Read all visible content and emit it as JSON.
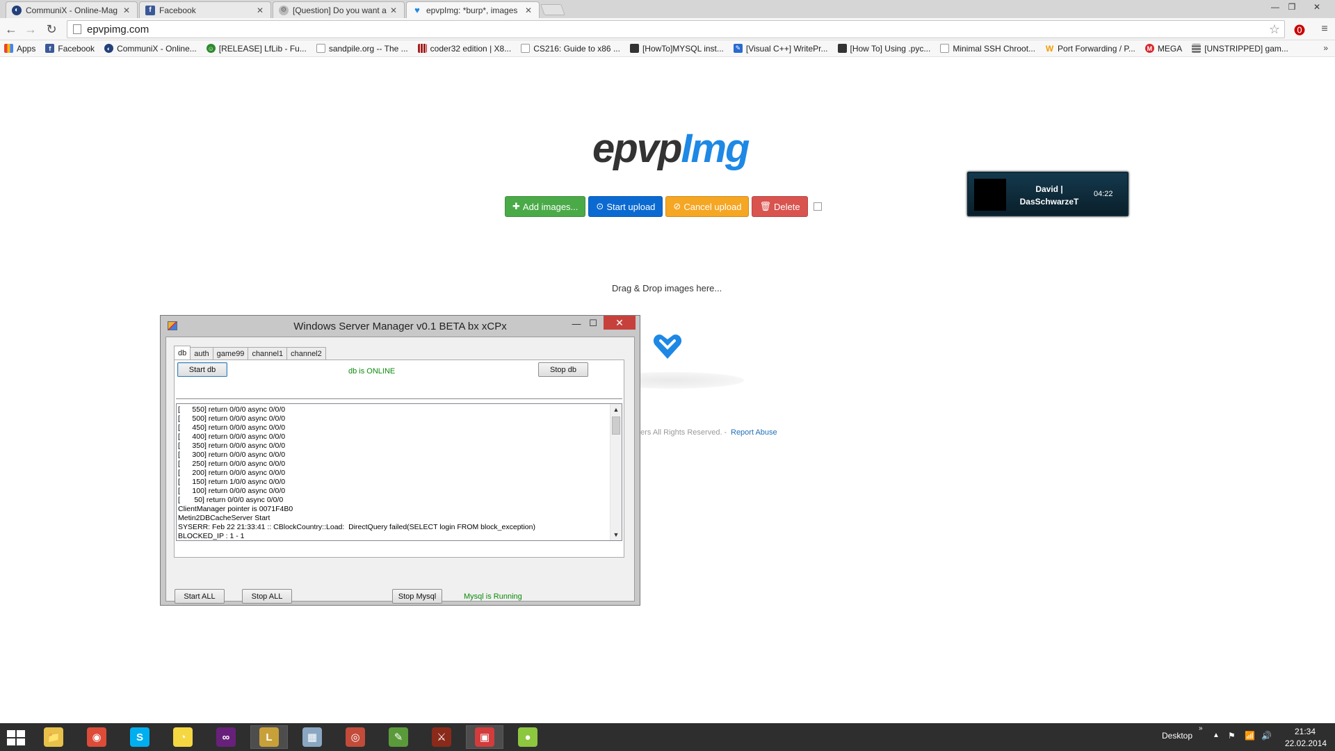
{
  "browser": {
    "tabs": [
      {
        "title": "CommuniX - Online-Mag",
        "favicon_color": "#22407a",
        "active": false
      },
      {
        "title": "Facebook",
        "favicon_color": "#3b5998",
        "active": false
      },
      {
        "title": "[Question] Do you want a",
        "favicon_color": "#888888",
        "active": false
      },
      {
        "title": "epvpImg: *burp*, images",
        "favicon_color": "#1e88e5",
        "active": true
      }
    ],
    "url": "epvpimg.com",
    "bookmarks": [
      {
        "label": "Apps",
        "icon": "apps-icon",
        "color": "#e94235"
      },
      {
        "label": "Facebook",
        "icon": "facebook-icon",
        "color": "#3b5998"
      },
      {
        "label": "CommuniX - Online...",
        "icon": "communix-icon",
        "color": "#22407a"
      },
      {
        "label": "[RELEASE] LfLib - Fu...",
        "icon": "smiley-icon",
        "color": "#2d8a2d"
      },
      {
        "label": "sandpile.org -- The ...",
        "icon": "page-icon",
        "color": "#ffffff"
      },
      {
        "label": "coder32 edition | X8...",
        "icon": "grid-icon",
        "color": "#a32020"
      },
      {
        "label": "CS216: Guide to x86 ...",
        "icon": "page-icon",
        "color": "#ffffff"
      },
      {
        "label": "[HowTo]MYSQL inst...",
        "icon": "forum-icon",
        "color": "#333333"
      },
      {
        "label": "[Visual C++] WritePr...",
        "icon": "cpp-icon",
        "color": "#2a6ad0"
      },
      {
        "label": "[How To] Using .pyc...",
        "icon": "forum-icon",
        "color": "#333333"
      },
      {
        "label": "Minimal SSH Chroot...",
        "icon": "page-icon",
        "color": "#ffffff"
      },
      {
        "label": "Port Forwarding / P...",
        "icon": "w-icon",
        "color": "#f59b00"
      },
      {
        "label": "MEGA",
        "icon": "mega-icon",
        "color": "#d9272e"
      },
      {
        "label": "[UNSTRIPPED] gam...",
        "icon": "grid-icon",
        "color": "#777777"
      }
    ],
    "bookmarks_more": "»"
  },
  "page": {
    "logo_part1": "epvp",
    "logo_part2": "Img",
    "buttons": {
      "add": "Add images...",
      "start": "Start upload",
      "cancel": "Cancel upload",
      "delete": "Delete"
    },
    "drag_text": "Drag & Drop images here...",
    "footer_text": "bers All Rights Reserved. -",
    "footer_link": "Report Abuse"
  },
  "notification": {
    "name_line1": "David |",
    "name_line2": "DasSchwarzeT",
    "time": "04:22"
  },
  "server_manager": {
    "title": "Windows Server Manager v0.1 BETA bx xCPx",
    "tabs": [
      "db",
      "auth",
      "game99",
      "channel1",
      "channel2"
    ],
    "active_tab": "db",
    "start_db": "Start db",
    "stop_db": "Stop db",
    "db_status": "db is ONLINE",
    "log_lines": [
      "[      550] return 0/0/0 async 0/0/0",
      "[      500] return 0/0/0 async 0/0/0",
      "[      450] return 0/0/0 async 0/0/0",
      "[      400] return 0/0/0 async 0/0/0",
      "[      350] return 0/0/0 async 0/0/0",
      "[      300] return 0/0/0 async 0/0/0",
      "[      250] return 0/0/0 async 0/0/0",
      "[      200] return 0/0/0 async 0/0/0",
      "[      150] return 1/0/0 async 0/0/0",
      "[      100] return 0/0/0 async 0/0/0",
      "[       50] return 0/0/0 async 0/0/0",
      "ClientManager pointer is 0071F4B0",
      "Metin2DBCacheServer Start",
      "SYSERR: Feb 22 21:33:41 :: CBlockCountry::Load:  DirectQuery failed(SELECT login FROM block_exception)",
      "BLOCKED_IP : 1 - 1"
    ],
    "start_all": "Start ALL",
    "stop_all": "Stop ALL",
    "stop_mysql": "Stop Mysql",
    "mysql_status": "Mysql is Running"
  },
  "taskbar": {
    "apps": [
      {
        "name": "file-explorer-icon",
        "color": "#e8c14a"
      },
      {
        "name": "chrome-icon",
        "color": "#dd4b39"
      },
      {
        "name": "skype-icon",
        "color": "#00aff0"
      },
      {
        "name": "pacman-icon",
        "color": "#f5d742"
      },
      {
        "name": "visual-studio-icon",
        "color": "#68217a"
      },
      {
        "name": "league-icon",
        "color": "#c8a03a"
      },
      {
        "name": "media-icon",
        "color": "#8aa7c2"
      },
      {
        "name": "games-icon",
        "color": "#c24b3a"
      },
      {
        "name": "notepad-icon",
        "color": "#5a9a3a"
      },
      {
        "name": "metin-icon",
        "color": "#8a2a1a"
      },
      {
        "name": "server-manager-icon",
        "color": "#d33c3c"
      },
      {
        "name": "joinme-icon",
        "color": "#8dc63f"
      }
    ],
    "desktop_label": "Desktop",
    "chevron": "»",
    "time": "21:34",
    "date": "22.02.2014"
  }
}
